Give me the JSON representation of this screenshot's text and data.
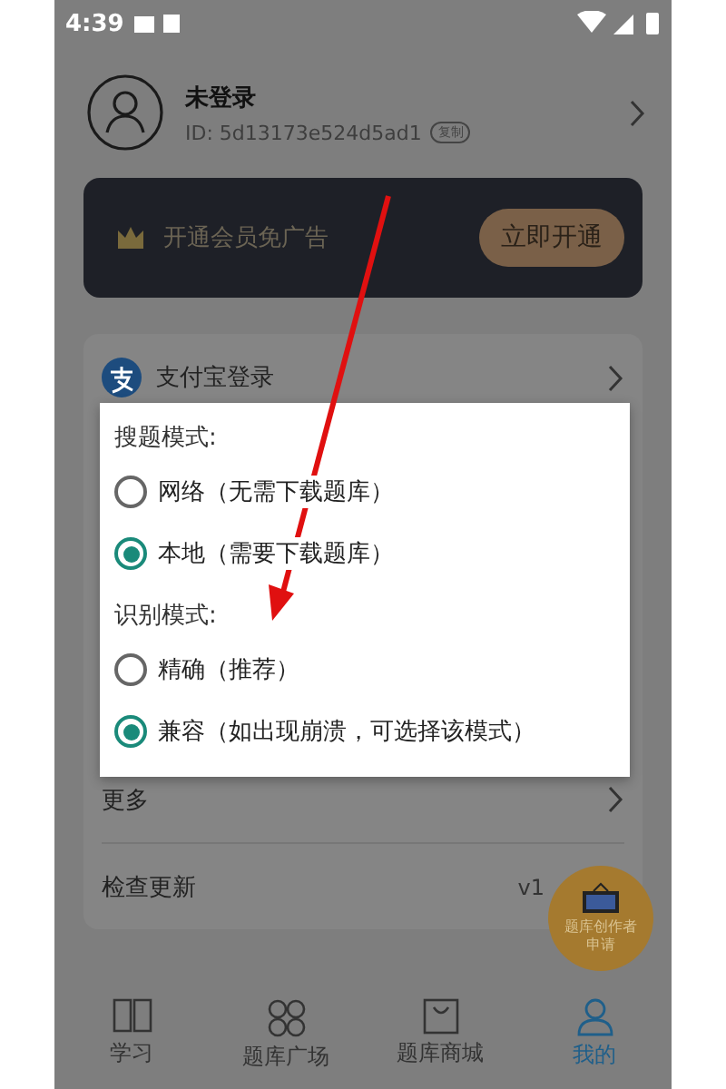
{
  "status_bar": {
    "time": "4:39"
  },
  "profile": {
    "name": "未登录",
    "id": "ID: 5d13173e524d5ad1",
    "copy_tag": "复制"
  },
  "vip_banner": {
    "text": "开通会员免广告",
    "button": "立即开通"
  },
  "menu": [
    {
      "kind": "alipay",
      "label": "支付宝登录"
    },
    {
      "kind": "link",
      "label": "更多"
    },
    {
      "kind": "version",
      "label": "检查更新",
      "value": "v1"
    }
  ],
  "dialog": {
    "sections": [
      {
        "title": "搜题模式:",
        "options": [
          {
            "label": "网络（无需下载题库）",
            "selected": false
          },
          {
            "label": "本地（需要下载题库）",
            "selected": true
          }
        ]
      },
      {
        "title": "识别模式:",
        "options": [
          {
            "label": "精确（推荐）",
            "selected": false
          },
          {
            "label": "兼容（如出现崩溃，可选择该模式）",
            "selected": true
          }
        ]
      }
    ]
  },
  "floating_badge": {
    "text": "题库创作者申请"
  },
  "bottom_nav": [
    {
      "kind": "book",
      "label": "学习",
      "selected": false
    },
    {
      "kind": "grid",
      "label": "题库广场",
      "selected": false
    },
    {
      "kind": "bag",
      "label": "题库商城",
      "selected": false
    },
    {
      "kind": "person",
      "label": "我的",
      "selected": true
    }
  ]
}
